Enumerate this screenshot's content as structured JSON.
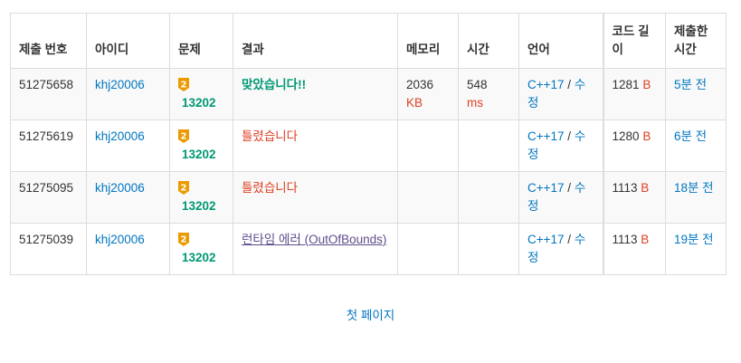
{
  "columns": [
    "제출 번호",
    "아이디",
    "문제",
    "결과",
    "메모리",
    "시간",
    "언어",
    "코드 길이",
    "제출한 시간"
  ],
  "rows": [
    {
      "id": "51275658",
      "user": "khj20006",
      "tier": "2",
      "problem": "13202",
      "result": "맞았습니다!!",
      "result_type": "ac",
      "memory": "2036",
      "memory_unit": "KB",
      "time": "548",
      "time_unit": "ms",
      "lang": "C++17",
      "lang_sep": " / ",
      "edit": "수정",
      "length": "1281",
      "length_unit": "B",
      "submitted": "5분 전"
    },
    {
      "id": "51275619",
      "user": "khj20006",
      "tier": "2",
      "problem": "13202",
      "result": "틀렸습니다",
      "result_type": "wa",
      "memory": "",
      "memory_unit": "",
      "time": "",
      "time_unit": "",
      "lang": "C++17",
      "lang_sep": " / ",
      "edit": "수정",
      "length": "1280",
      "length_unit": "B",
      "submitted": "6분 전"
    },
    {
      "id": "51275095",
      "user": "khj20006",
      "tier": "2",
      "problem": "13202",
      "result": "틀렸습니다",
      "result_type": "wa",
      "memory": "",
      "memory_unit": "",
      "time": "",
      "time_unit": "",
      "lang": "C++17",
      "lang_sep": " / ",
      "edit": "수정",
      "length": "1113",
      "length_unit": "B",
      "submitted": "18분 전"
    },
    {
      "id": "51275039",
      "user": "khj20006",
      "tier": "2",
      "problem": "13202",
      "result": "런타임 에러 (OutOfBounds)",
      "result_type": "rte",
      "memory": "",
      "memory_unit": "",
      "time": "",
      "time_unit": "",
      "lang": "C++17",
      "lang_sep": " / ",
      "edit": "수정",
      "length": "1113",
      "length_unit": "B",
      "submitted": "19분 전"
    }
  ],
  "tier_color": "#ec9a00",
  "tier_icon": "gold-tier-icon",
  "pager": {
    "first_page": "첫 페이지"
  }
}
